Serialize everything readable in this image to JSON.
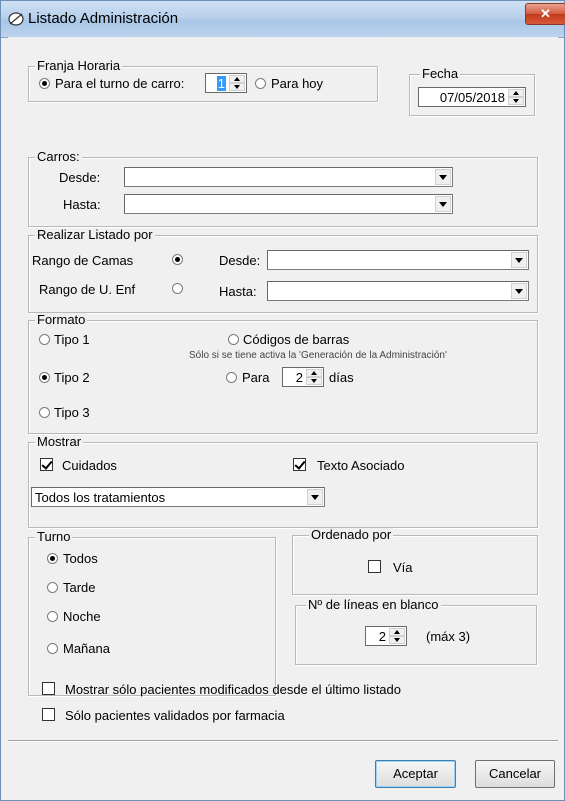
{
  "window": {
    "title": "Listado Administración",
    "close_label": "✕"
  },
  "franja": {
    "title": "Franja Horaria",
    "option_turno": "Para el turno de carro:",
    "turno_value": "1",
    "option_hoy": "Para hoy",
    "selected": "turno"
  },
  "fecha": {
    "title": "Fecha",
    "value": "07/05/2018"
  },
  "carros": {
    "title": "Carros:",
    "desde_label": "Desde:",
    "hasta_label": "Hasta:",
    "desde_value": "",
    "hasta_value": ""
  },
  "realizar": {
    "title": "Realizar Listado por",
    "opt_camas": "Rango de Camas",
    "opt_uenf": "Rango de U. Enf",
    "selected": "camas",
    "desde_label": "Desde:",
    "hasta_label": "Hasta:",
    "desde_value": "",
    "hasta_value": ""
  },
  "formato": {
    "title": "Formato",
    "tipo1": "Tipo 1",
    "tipo2": "Tipo 2",
    "tipo3": "Tipo 3",
    "selected": "tipo2",
    "codigos": "Códigos de barras",
    "codigos_note": "Sólo si se tiene activa la 'Generación de la Administración'",
    "para_label": "Para",
    "dias_value": "2",
    "dias_label": "días"
  },
  "mostrar": {
    "title": "Mostrar",
    "cuidados": "Cuidados",
    "cuidados_checked": true,
    "texto": "Texto Asociado",
    "texto_checked": true,
    "tratamientos_value": "Todos los tratamientos"
  },
  "turno": {
    "title": "Turno",
    "todos": "Todos",
    "tarde": "Tarde",
    "noche": "Noche",
    "manana": "Mañana",
    "selected": "todos"
  },
  "ordenado": {
    "title": "Ordenado por",
    "via": "Vía",
    "via_checked": false
  },
  "lineas": {
    "title": "Nº de líneas en blanco",
    "value": "2",
    "max_label": "(máx 3)"
  },
  "opciones": {
    "modificados": "Mostrar sólo pacientes modificados desde el último listado",
    "validados": "Sólo pacientes validados por farmacia"
  },
  "buttons": {
    "aceptar": "Aceptar",
    "cancelar": "Cancelar"
  }
}
